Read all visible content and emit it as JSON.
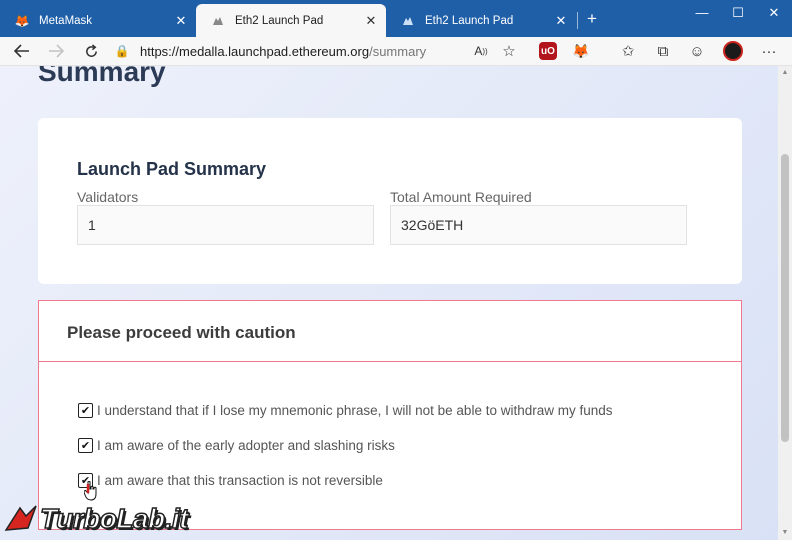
{
  "tabs": [
    {
      "title": "MetaMask",
      "active": false,
      "icon": "fox-icon"
    },
    {
      "title": "Eth2 Launch Pad",
      "active": true,
      "icon": "rhino-icon"
    },
    {
      "title": "Eth2 Launch Pad",
      "active": false,
      "icon": "rhino-icon"
    }
  ],
  "window_controls": {
    "minimize": "—",
    "maximize": "☐",
    "close": "✕"
  },
  "address_bar": {
    "url_host": "https://medalla.launchpad.ethereum.org",
    "url_path": "/summary"
  },
  "page": {
    "heading": "Summary",
    "summary_card": {
      "title": "Launch Pad Summary",
      "validators_label": "Validators",
      "validators_value": "1",
      "total_label": "Total Amount Required",
      "total_value": "32GöETH"
    },
    "caution": {
      "title": "Please proceed with caution",
      "items": [
        {
          "label": "I understand that if I lose my mnemonic phrase, I will not be able to withdraw my funds",
          "checked": true
        },
        {
          "label": "I am aware of the early adopter and slashing risks",
          "checked": true
        },
        {
          "label": "I am aware that this transaction is not reversible",
          "checked": true
        }
      ]
    }
  },
  "watermark": {
    "text": "TurboLab.it"
  },
  "colors": {
    "tabstrip": "#1f5fa8",
    "caution_border": "#f07a8d",
    "heading": "#2b3a55"
  }
}
